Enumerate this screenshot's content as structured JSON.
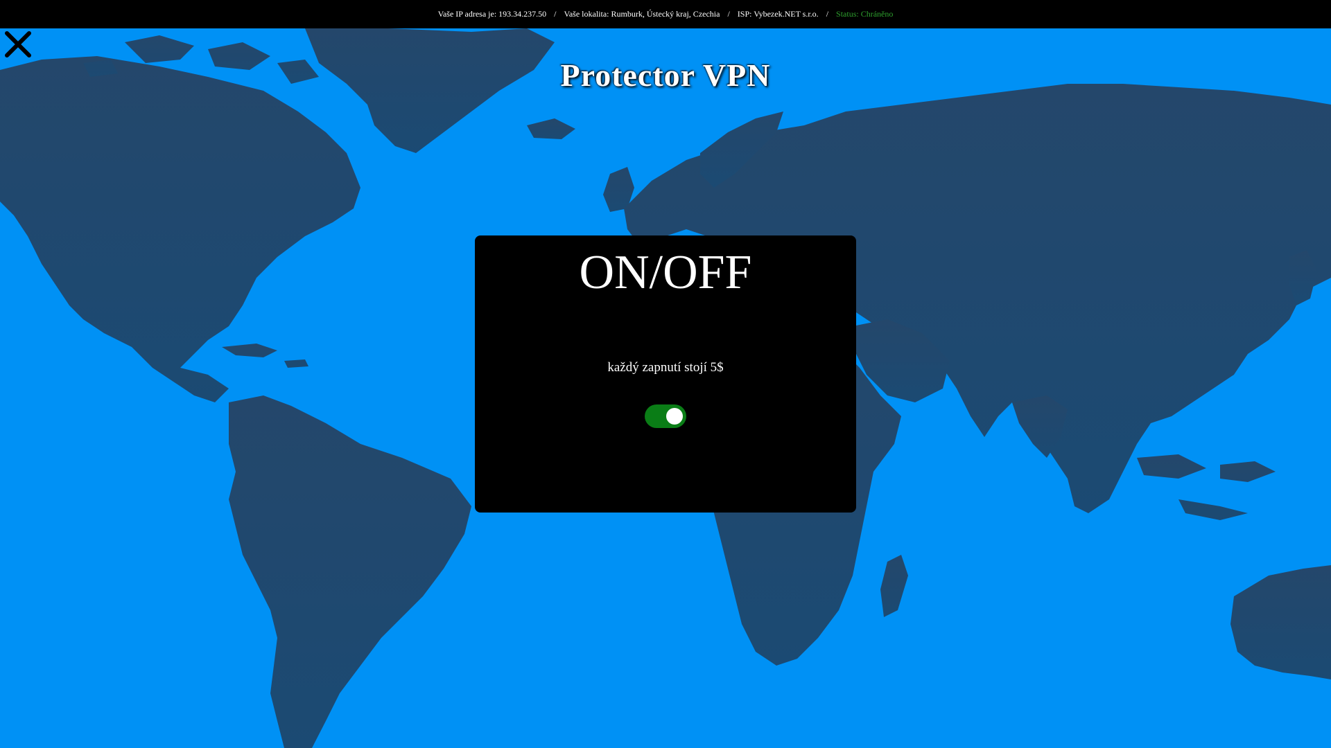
{
  "topbar": {
    "ip_label": "Vaše IP adresa je: 193.34.237.50",
    "location_label": "Vaše lokalita: Rumburk, Ústecký kraj, Czechia",
    "isp_label": "ISP: Vybezek.NET s.r.o.",
    "status_label": "Status: Chráněno",
    "separator": "/"
  },
  "app": {
    "title": "Protector VPN"
  },
  "vpn_panel": {
    "heading": "ON/OFF",
    "note": "každý zapnutí stojí 5$",
    "toggle_on": true
  },
  "icons": {
    "close": "close-icon"
  },
  "colors": {
    "ocean": "#0091f5",
    "land": "#1e4a6e",
    "panel": "#000000",
    "toggle_on": "#0a7d16",
    "toggle_off": "#666666",
    "status": "#2ea12e"
  }
}
